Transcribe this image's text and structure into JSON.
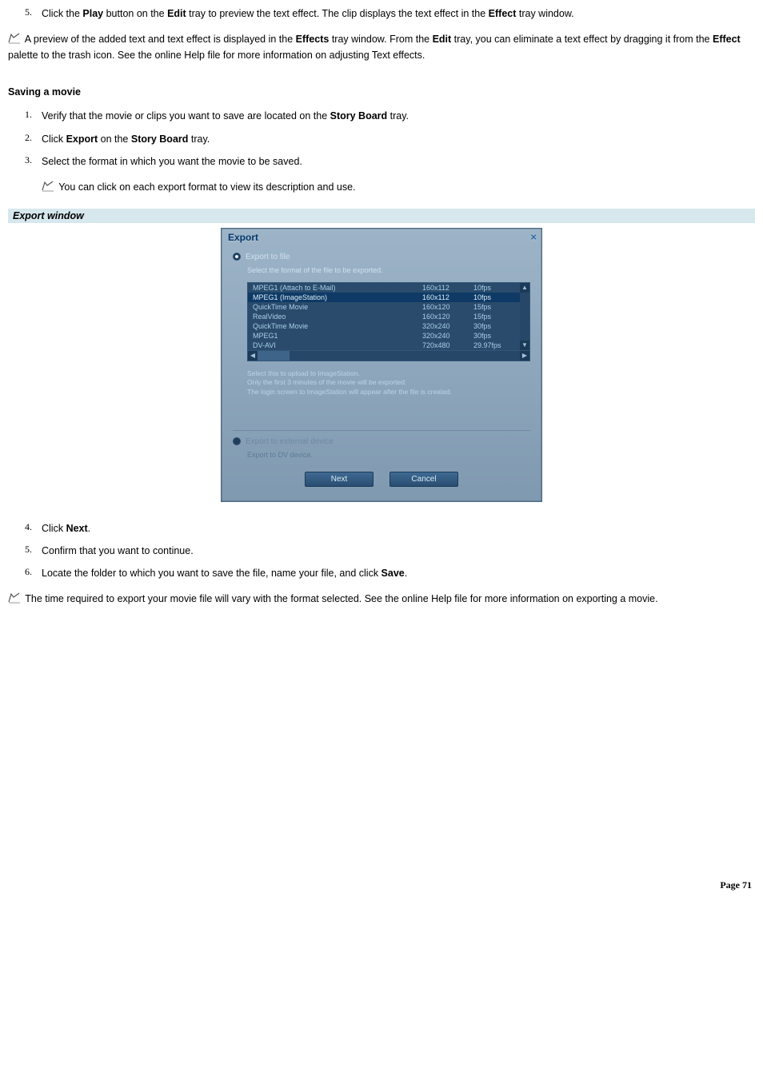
{
  "step5": {
    "num": "5.",
    "text_parts": [
      "Click the ",
      "Play",
      " button on the ",
      "Edit",
      " tray to preview the text effect. The clip displays the text effect in the ",
      "Effect",
      " tray window."
    ]
  },
  "note1_parts": [
    " A preview of the added text and text effect is displayed in the ",
    "Effects",
    " tray window. From the ",
    "Edit",
    " tray, you can eliminate a text effect by dragging it from the ",
    "Effect",
    " palette to the trash icon. See the online Help file for more information on adjusting Text effects."
  ],
  "saving_heading": "Saving a movie",
  "saving_steps_a": [
    {
      "num": "1.",
      "parts": [
        "Verify that the movie or clips you want to save are located on the ",
        "Story Board",
        " tray."
      ]
    },
    {
      "num": "2.",
      "parts": [
        "Click ",
        "Export",
        " on the ",
        "Story Board",
        " tray."
      ]
    },
    {
      "num": "3.",
      "parts": [
        "Select the format in which you want the movie to be saved."
      ]
    }
  ],
  "note2": " You can click on each export format to view its description and use.",
  "banner": "Export window",
  "export": {
    "title": "Export",
    "close": "×",
    "radio1": "Export to file",
    "sub1": "Select the format of the file to be exported.",
    "formats": [
      {
        "name": "MPEG1 (Attach to E-Mail)",
        "res": "160x112",
        "fps": "10fps",
        "sel": false
      },
      {
        "name": "MPEG1 (ImageStation)",
        "res": "160x112",
        "fps": "10fps",
        "sel": true
      },
      {
        "name": "QuickTime Movie",
        "res": "160x120",
        "fps": "15fps",
        "sel": false
      },
      {
        "name": "RealVideo",
        "res": "160x120",
        "fps": "15fps",
        "sel": false
      },
      {
        "name": "QuickTime Movie",
        "res": "320x240",
        "fps": "30fps",
        "sel": false
      },
      {
        "name": "MPEG1",
        "res": "320x240",
        "fps": "30fps",
        "sel": false
      },
      {
        "name": "DV-AVI",
        "res": "720x480",
        "fps": "29.97fps",
        "sel": false
      }
    ],
    "desc_lines": [
      "Select this to upload to ImageStation.",
      "Only the first 3 minutes of the movie will be exported.",
      "The login screen to ImageStation will appear after the file is created."
    ],
    "radio2": "Export to external device",
    "sub2": "Export to DV device.",
    "btn_next": "Next",
    "btn_cancel": "Cancel"
  },
  "saving_steps_b": [
    {
      "num": "4.",
      "parts": [
        "Click ",
        "Next",
        "."
      ]
    },
    {
      "num": "5.",
      "parts": [
        "Confirm that you want to continue."
      ]
    },
    {
      "num": "6.",
      "parts": [
        "Locate the folder to which you want to save the file, name your file, and click ",
        "Save",
        "."
      ]
    }
  ],
  "note3": " The time required to export your movie file will vary with the format selected. See the online Help file for more information on exporting a movie.",
  "page_num": "Page 71"
}
